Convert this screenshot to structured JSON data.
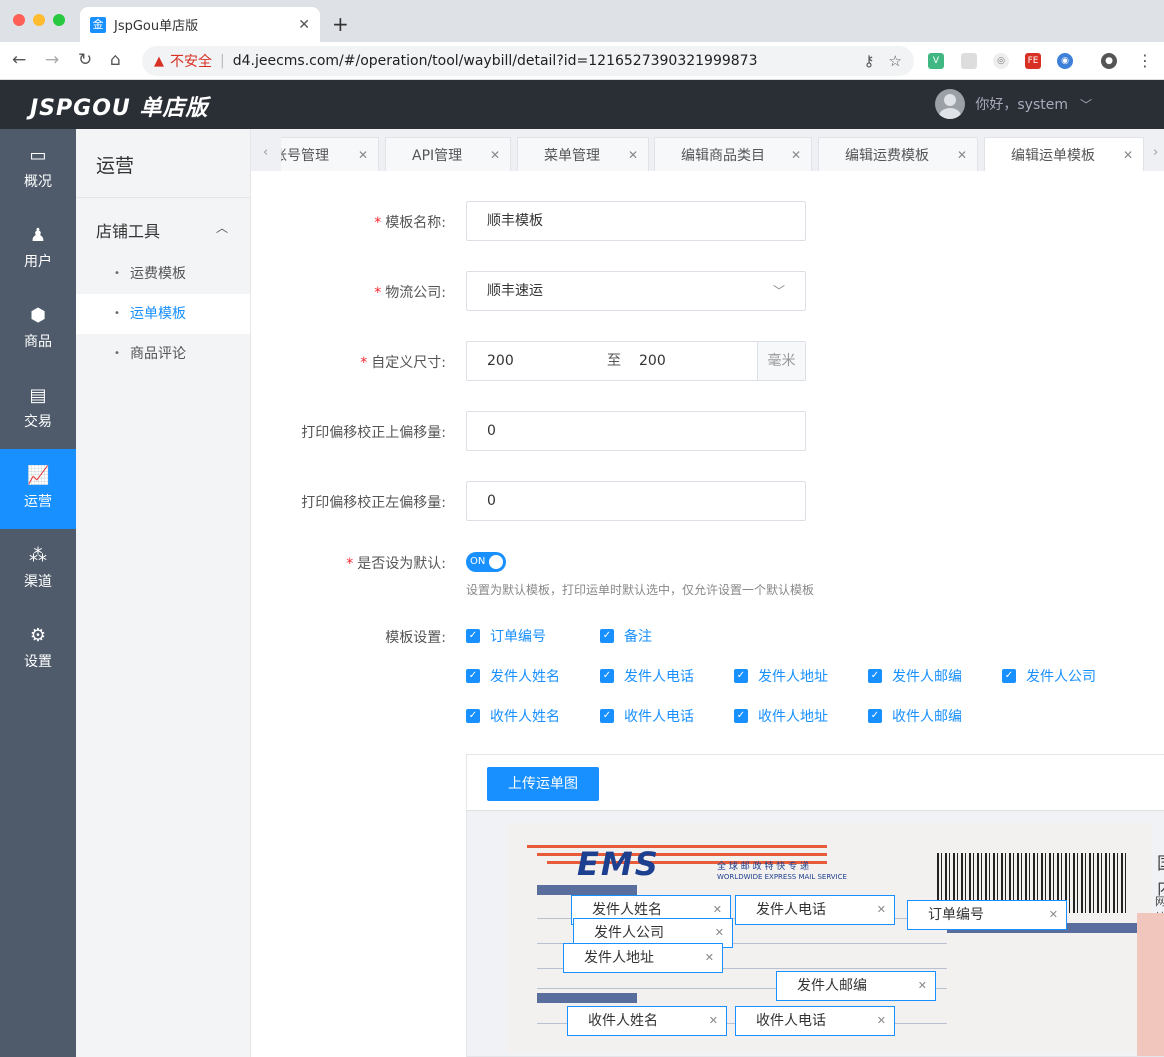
{
  "browser": {
    "tab_title": "JspGou单店版",
    "tab_favicon": "金",
    "not_secure": "不安全",
    "url": "d4.jeecms.com/#/operation/tool/waybill/detail?id=1216527390321999873"
  },
  "header": {
    "brand": "JSPGOU 单店版",
    "greeting": "你好，system"
  },
  "sidebar": {
    "items": [
      {
        "label": "概况",
        "icon": "monitor-icon"
      },
      {
        "label": "用户",
        "icon": "user-icon"
      },
      {
        "label": "商品",
        "icon": "box-icon"
      },
      {
        "label": "交易",
        "icon": "document-icon"
      },
      {
        "label": "运营",
        "icon": "chart-icon"
      },
      {
        "label": "渠道",
        "icon": "cluster-icon"
      },
      {
        "label": "设置",
        "icon": "gear-icon"
      }
    ],
    "active": "运营"
  },
  "subnav": {
    "title": "运营",
    "group": "店铺工具",
    "items": [
      "运费模板",
      "运单模板",
      "商品评论"
    ],
    "active": "运单模板"
  },
  "page_tabs": [
    {
      "label": "账号管理"
    },
    {
      "label": "API管理"
    },
    {
      "label": "菜单管理"
    },
    {
      "label": "编辑商品类目"
    },
    {
      "label": "编辑运费模板"
    },
    {
      "label": "编辑运单模板"
    }
  ],
  "form": {
    "name_label": "模板名称:",
    "name_value": "顺丰模板",
    "company_label": "物流公司:",
    "company_value": "顺丰速运",
    "size_label": "自定义尺寸:",
    "size_from": "200",
    "size_sep": "至",
    "size_to": "200",
    "size_unit": "毫米",
    "offset_top_label": "打印偏移校正上偏移量:",
    "offset_top_value": "0",
    "offset_left_label": "打印偏移校正左偏移量:",
    "offset_left_value": "0",
    "default_label": "是否设为默认:",
    "default_switch": "ON",
    "default_hint": "设置为默认模板，打印运单时默认选中，仅允许设置一个默认模板",
    "template_label": "模板设置:",
    "checkbox_rows": [
      [
        "订单编号",
        "备注"
      ],
      [
        "发件人姓名",
        "发件人电话",
        "发件人地址",
        "发件人邮编",
        "发件人公司"
      ],
      [
        "收件人姓名",
        "收件人电话",
        "收件人地址",
        "收件人邮编"
      ]
    ]
  },
  "designer": {
    "upload_label": "上传运单图",
    "waybill_logo": "EMS",
    "waybill_subtitle": "全 球 邮 政 特 快 专 递",
    "waybill_subtitle_en": "WORLDWIDE EXPRESS MAIL SERVICE",
    "waybill_heading": "国内",
    "waybill_web": "网站：",
    "field_tags": [
      "发件人姓名",
      "发件人电话",
      "订单编号",
      "发件人公司",
      "发件人地址",
      "发件人邮编",
      "收件人姓名",
      "收件人电话"
    ]
  }
}
